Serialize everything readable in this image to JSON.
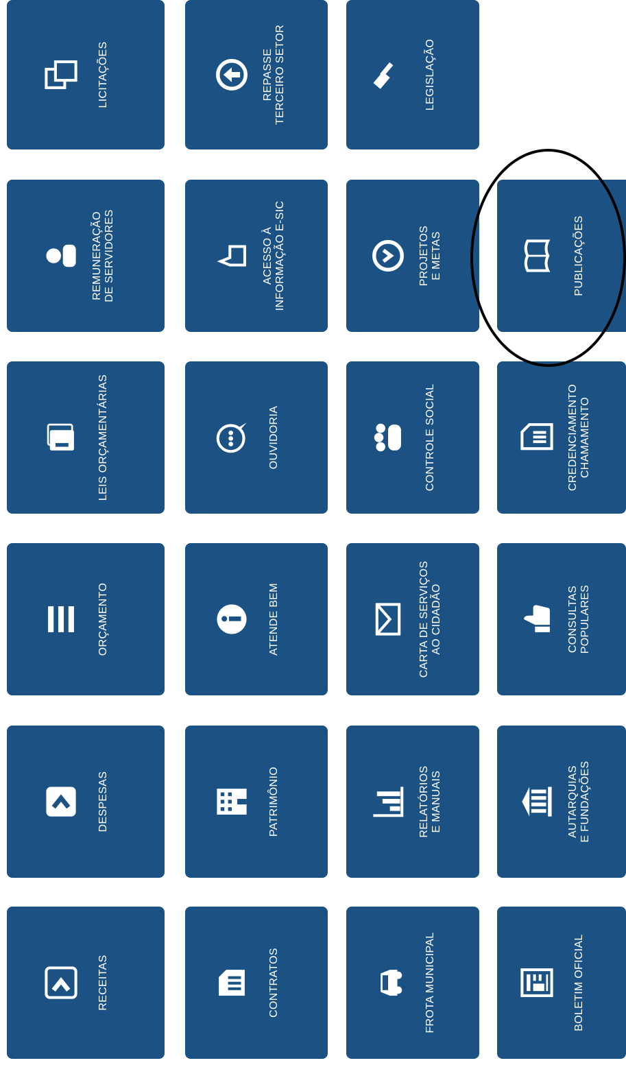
{
  "accent_color": "#1b5283",
  "tiles": [
    {
      "label": "LICITAÇÕES",
      "icon": "copy-documents-icon"
    },
    {
      "label": "REPASSE\nTERCEIRO SETOR",
      "icon": "upload-circle-icon"
    },
    {
      "label": "LEGISLAÇÃO",
      "icon": "gavel-icon"
    },
    {
      "label": "REMUNERAÇÃO\nDE SERVIDORES",
      "icon": "user-icon"
    },
    {
      "label": "ACESSO À\nINFORMAÇÃO E-SIC",
      "icon": "pointing-hand-icon"
    },
    {
      "label": "PROJETOS\nE METAS",
      "icon": "chevron-circle-icon"
    },
    {
      "label": "PUBLICAÇÕES",
      "icon": "open-book-icon"
    },
    {
      "label": "LEIS ORÇAMENTÁRIAS",
      "icon": "books-icon"
    },
    {
      "label": "OUVIDORIA",
      "icon": "speech-bubble-icon"
    },
    {
      "label": "CONTROLE SOCIAL",
      "icon": "group-people-icon"
    },
    {
      "label": "CREDENCIAMENTO\nCHAMAMENTO",
      "icon": "document-list-icon"
    },
    {
      "label": "ORÇAMENTO",
      "icon": "bars-icon"
    },
    {
      "label": "ATENDE BEM",
      "icon": "info-circle-icon"
    },
    {
      "label": "CARTA DE SERVIÇOS\nAO CIDADÃO",
      "icon": "envelope-icon"
    },
    {
      "label": "CONSULTAS\nPOPULARES",
      "icon": "thumbs-up-icon"
    },
    {
      "label": "DESPESAS",
      "icon": "arrow-box-icon"
    },
    {
      "label": "PATRIMÔNIO",
      "icon": "building-icon"
    },
    {
      "label": "RELATÓRIOS\nE MANUAIS",
      "icon": "bar-chart-icon"
    },
    {
      "label": "AUTARQUIAS\nE FUNDAÇÕES",
      "icon": "institution-icon"
    },
    {
      "label": "RECEITAS",
      "icon": "arrow-in-box-icon"
    },
    {
      "label": "CONTRATOS",
      "icon": "contract-icon"
    },
    {
      "label": "FROTA MUNICIPAL",
      "icon": "car-icon"
    },
    {
      "label": "BOLETIM OFICIAL",
      "icon": "newspaper-icon"
    }
  ]
}
